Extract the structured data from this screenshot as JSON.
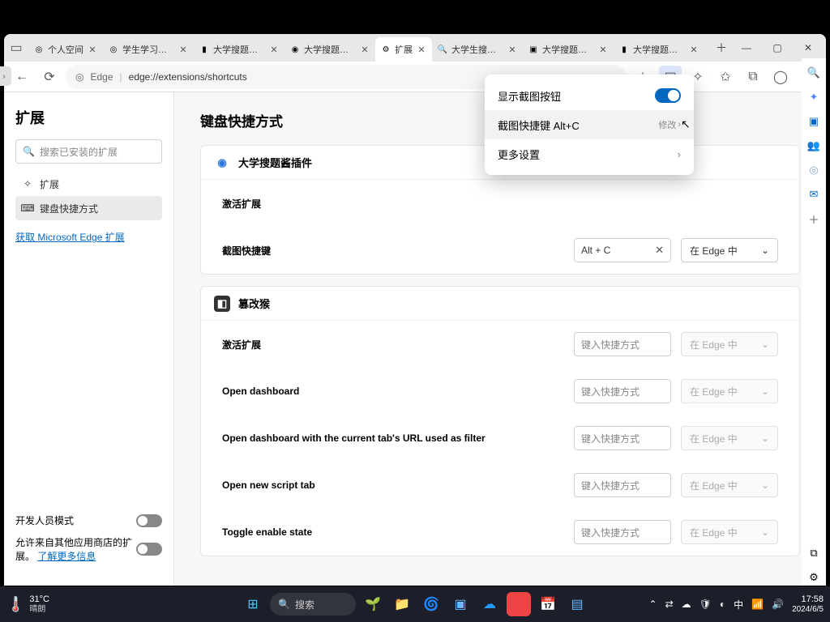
{
  "tabs": [
    {
      "title": "个人空间",
      "fav": "◎"
    },
    {
      "title": "学生学习页面",
      "fav": "◎"
    },
    {
      "title": "大学搜题酱插件",
      "fav": "▮"
    },
    {
      "title": "大学搜题酱插件",
      "fav": "◉"
    },
    {
      "title": "扩展",
      "fav": "⚙",
      "active": true
    },
    {
      "title": "大学生搜题酱",
      "fav": "🔍"
    },
    {
      "title": "大学搜题酱PC",
      "fav": "▣"
    },
    {
      "title": "大学搜题酱插件",
      "fav": "▮"
    }
  ],
  "url": {
    "secure_label": "Edge",
    "path": "edge://extensions/shortcuts"
  },
  "sidebar_ext": {
    "title": "扩展",
    "search_placeholder": "搜索已安装的扩展",
    "nav_ext": "扩展",
    "nav_kb": "键盘快捷方式",
    "get_link": "获取 Microsoft Edge 扩展",
    "dev_mode": "开发人员模式",
    "other_store": "允许来自其他应用商店的扩展。",
    "learn_more": "了解更多信息"
  },
  "page": {
    "heading": "键盘快捷方式",
    "ext1": {
      "name": "大学搜题酱插件",
      "row_activate": "激活扩展",
      "row_shortcut": "截图快捷键",
      "shortcut_value": "Alt + C",
      "scope": "在 Edge 中"
    },
    "ext2": {
      "name": "篡改猴",
      "rows": [
        {
          "label": "激活扩展"
        },
        {
          "label": "Open dashboard"
        },
        {
          "label": "Open dashboard with the current tab's URL used as filter"
        },
        {
          "label": "Open new script tab"
        },
        {
          "label": "Toggle enable state"
        }
      ],
      "placeholder": "键入快捷方式",
      "scope": "在 Edge 中"
    }
  },
  "popup": {
    "row1": "显示截图按钮",
    "row2": "截图快捷键 Alt+C",
    "row2_action": "修改",
    "row3": "更多设置"
  },
  "taskbar": {
    "temp": "31°C",
    "weather": "晴朗",
    "search": "搜索",
    "time": "17:58",
    "date": "2024/6/5"
  }
}
